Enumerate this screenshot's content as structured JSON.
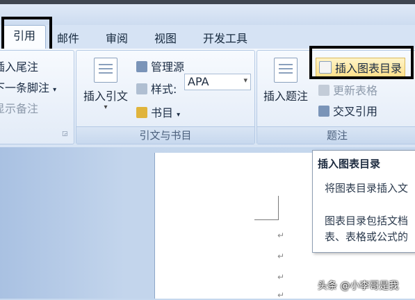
{
  "tabs": [
    "引用",
    "邮件",
    "审阅",
    "视图",
    "开发工具"
  ],
  "footnotes_group": {
    "insert_endnote": "插入尾注",
    "next_footnote": "下一条脚注",
    "show_notes": "显示备注"
  },
  "citations_group": {
    "insert_citation": "插入引文",
    "manage_sources": "管理源",
    "style_label": "样式:",
    "style_value": "APA",
    "bibliography": "书目",
    "label": "引文与书目"
  },
  "captions_group": {
    "insert_caption": "插入题注",
    "insert_table_of_figures": "插入图表目录",
    "update_table": "更新表格",
    "cross_reference": "交叉引用",
    "label": "题注"
  },
  "tooltip": {
    "title": "插入图表目录",
    "line1": "将图表目录插入文",
    "line2": "图表目录包括文档",
    "line3": "表、表格或公式的"
  },
  "watermark": "头条 @小李哥是我",
  "colors": {
    "highlight_border": "#000000",
    "accent_button": "#ffe79a"
  }
}
